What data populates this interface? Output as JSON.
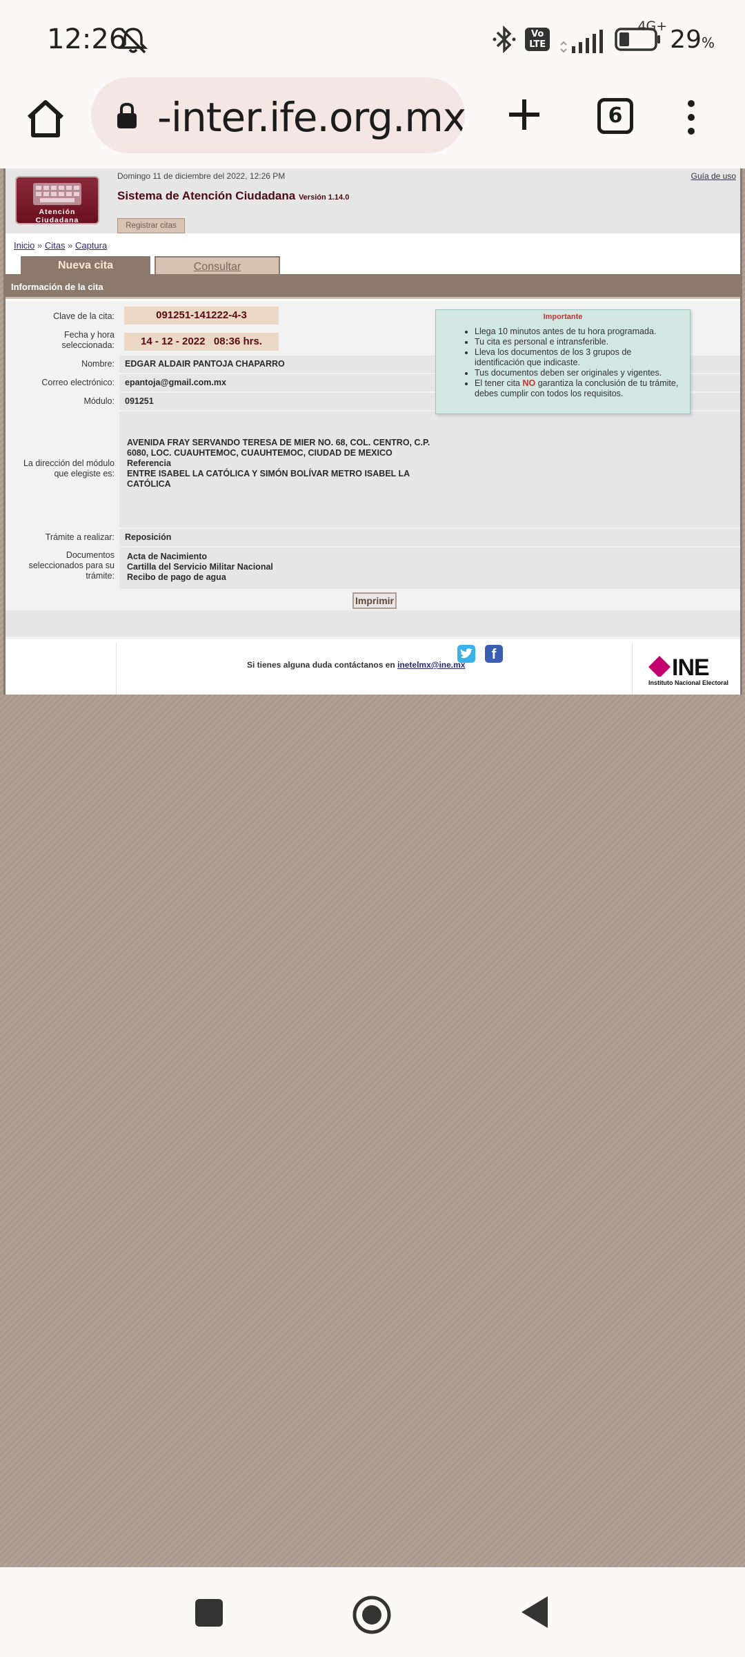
{
  "status_bar": {
    "time": "12:26",
    "volte": "Vo LTE",
    "network": "4G+",
    "battery_percent": "29",
    "battery_unit": "%",
    "battery_level": 0.29
  },
  "browser": {
    "url": "-inter.ife.org.mx",
    "tab_count": "6"
  },
  "header": {
    "date": "Domingo 11 de diciembre del 2022, 12:26 PM",
    "guide_link": "Guía de uso",
    "system_title": "Sistema de Atención Ciudadana",
    "version": "Versión 1.14.0",
    "register_button": "Registrar citas",
    "logo_line1": "Atención",
    "logo_line2": "Ciudadana"
  },
  "breadcrumb": {
    "inicio": "Inicio",
    "sep": "»",
    "citas": "Citas",
    "captura": "Captura"
  },
  "tabs": {
    "new": "Nueva cita",
    "consult": "Consultar"
  },
  "section_title": "Información de la cita",
  "form": {
    "clave_label": "Clave de la cita:",
    "clave_value": "091251-141222-4-3",
    "fecha_label_1": "Fecha y hora",
    "fecha_label_2": "seleccionada:",
    "fecha_value": "14 - 12 - 2022   08:36 hrs.",
    "nombre_label": "Nombre:",
    "nombre_value": "EDGAR ALDAIR PANTOJA CHAPARRO",
    "correo_label": "Correo electrónico:",
    "correo_value": "epantoja@gmail.com.mx",
    "modulo_label": "Módulo:",
    "modulo_value": "091251",
    "direccion_label_1": "La dirección del módulo",
    "direccion_label_2": "que elegiste es:",
    "direccion_line1": "AVENIDA FRAY SERVANDO TERESA DE MIER NO. 68, COL. CENTRO, C.P.",
    "direccion_line2": "6080, LOC. CUAUHTEMOC, CUAUHTEMOC, CIUDAD DE MEXICO",
    "referencia_label": "Referencia",
    "referencia_line1": "ENTRE ISABEL LA CATÓLICA Y SIMÓN BOLÍVAR METRO ISABEL LA",
    "referencia_line2": "CATÓLICA",
    "tramite_label": "Trámite a realizar:",
    "tramite_value": "Reposición",
    "docs_label_1": "Documentos",
    "docs_label_2": "seleccionados para su",
    "docs_label_3": "trámite:",
    "documents": [
      "Acta de Nacimiento",
      "Cartilla del Servicio Militar Nacional",
      "Recibo de pago de agua"
    ],
    "print_button": "Imprimir"
  },
  "importante": {
    "title": "Importante",
    "item1": "Llega 10 minutos antes de tu hora programada.",
    "item2": "Tu cita es personal e intransferible.",
    "item3a": "Lleva los documentos de los 3 grupos de",
    "item3b": "identificación que indicaste.",
    "item4": "Tus documentos deben ser originales y vigentes.",
    "item5_pre": "El tener cita",
    "item5_no": "NO",
    "item5_post": "garantiza la conclusión de tu trámite,",
    "item5_b": "debes cumplir con todos los requisitos."
  },
  "footer": {
    "contact_text": "Si tienes alguna duda contáctanos en",
    "email": "inetelmx@ine.mx",
    "facebook_glyph": "f",
    "ine_word": "INE",
    "ine_sub": "Instituto Nacional Electoral"
  },
  "colors": {
    "brand_maroon": "#6b1020",
    "tab_brown": "#8b7a6c",
    "highlight": "#ead8c5",
    "background": "#ad9f92"
  }
}
